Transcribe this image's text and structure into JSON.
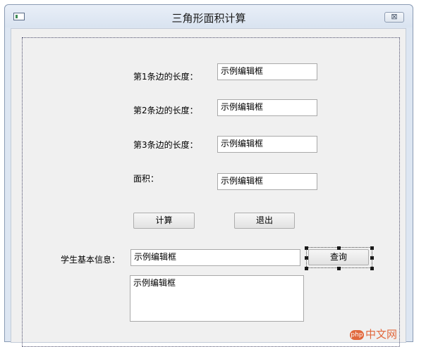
{
  "window": {
    "title": "三角形面积计算",
    "app_icon": "window-app-icon",
    "close_glyph": "⊠"
  },
  "form": {
    "side1_label": "第1条边的长度：",
    "side1_value": "示例编辑框",
    "side2_label": "第2条边的长度：",
    "side2_value": "示例编辑框",
    "side3_label": "第3条边的长度：",
    "side3_value": "示例编辑框",
    "area_label": "面积：",
    "area_value": "示例编辑框",
    "calc_button": "计算",
    "exit_button": "退出",
    "student_label": "学生基本信息：",
    "student_value": "示例编辑框",
    "query_button": "查询",
    "info_text": "示例编辑框"
  },
  "watermark": {
    "badge": "php",
    "text": "中文网"
  }
}
